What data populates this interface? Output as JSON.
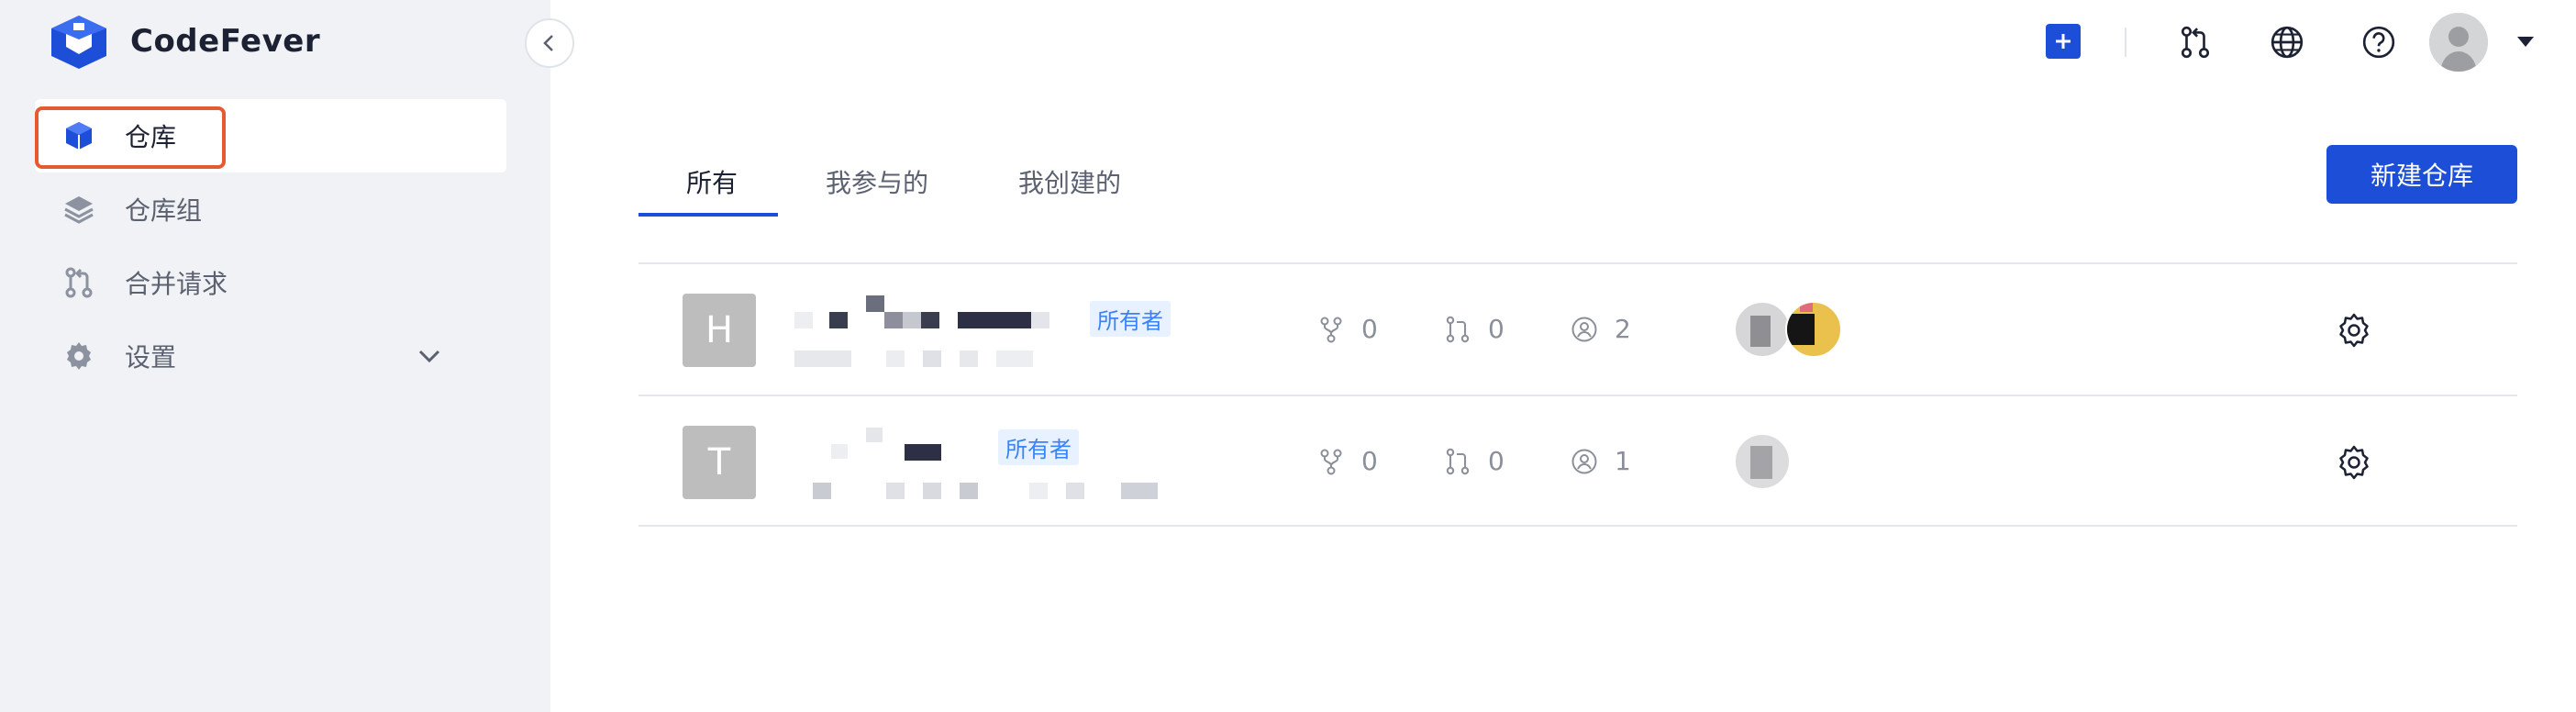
{
  "app": {
    "brand": "CodeFever",
    "accent": "#1d4ed8"
  },
  "sidebar": {
    "items": [
      {
        "label": "仓库",
        "icon": "cube-icon"
      },
      {
        "label": "仓库组",
        "icon": "layers-icon"
      },
      {
        "label": "合并请求",
        "icon": "merge-request-icon"
      },
      {
        "label": "设置",
        "icon": "gear-icon"
      }
    ]
  },
  "topbar": {
    "icons": [
      "plus-icon",
      "merge-request-icon",
      "globe-icon",
      "help-icon",
      "avatar",
      "caret-down-icon"
    ]
  },
  "tabs": [
    {
      "label": "所有"
    },
    {
      "label": "我参与的"
    },
    {
      "label": "我创建的"
    }
  ],
  "new_repo_button": "新建仓库",
  "repos": [
    {
      "initial": "H",
      "badge": "所有者",
      "forks": "0",
      "merge_requests": "0",
      "members": "2"
    },
    {
      "initial": "T",
      "badge": "所有者",
      "forks": "0",
      "merge_requests": "0",
      "members": "1"
    }
  ]
}
